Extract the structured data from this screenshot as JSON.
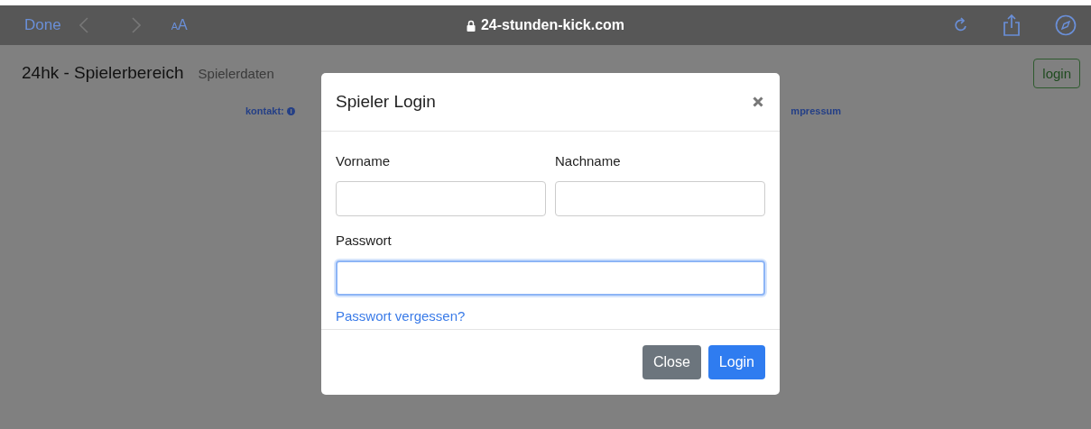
{
  "browser_bar": {
    "done": "Done",
    "text_size": "AA",
    "url": "24-stunden-kick.com"
  },
  "navbar": {
    "brand": "24hk - Spielerbereich",
    "items": [
      "Spielerdaten"
    ],
    "login": "login"
  },
  "footer_links": {
    "contact": "kontakt:",
    "imprint": "mpressum"
  },
  "modal": {
    "title": "Spieler Login",
    "fields": [
      {
        "label": "Vorname",
        "focused": false
      },
      {
        "label": "Nachname",
        "focused": false
      },
      {
        "label": "Passwort",
        "focused": true
      }
    ],
    "forgot_link": "Passwort vergessen?",
    "buttons": [
      {
        "label": "Close",
        "kind": "secondary"
      },
      {
        "label": "Login",
        "kind": "primary"
      }
    ]
  }
}
